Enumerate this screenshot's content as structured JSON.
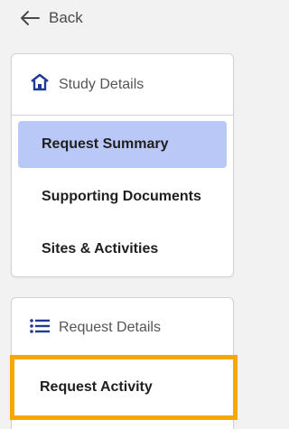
{
  "nav": {
    "back_label": "Back"
  },
  "study_card": {
    "title": "Study Details",
    "icon": "home-icon",
    "items": [
      {
        "label": "Request Summary",
        "active": true
      },
      {
        "label": "Supporting Documents",
        "active": false
      },
      {
        "label": "Sites & Activities",
        "active": false
      }
    ]
  },
  "request_card": {
    "title": "Request Details",
    "icon": "list-icon",
    "items": [
      {
        "label": "Request Activity",
        "highlighted": true
      }
    ]
  },
  "colors": {
    "active_bg": "#b9c8f7",
    "highlight_border": "#f5a800",
    "icon_blue": "#1f3a93"
  }
}
